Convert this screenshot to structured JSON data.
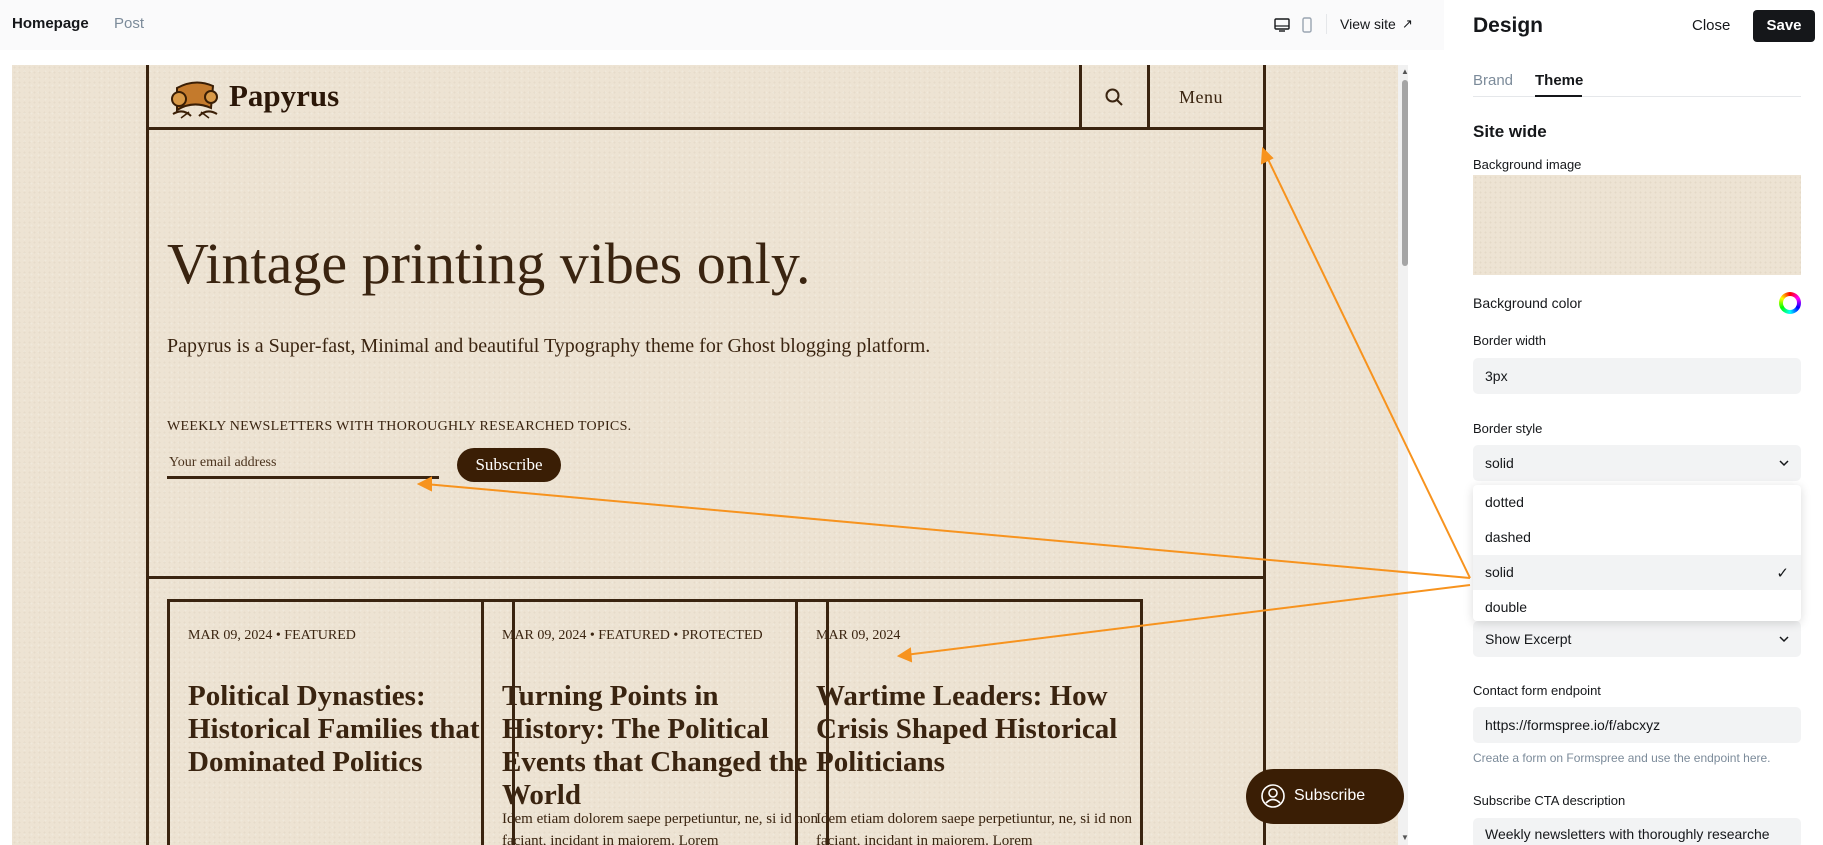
{
  "topbar": {
    "tabs": [
      {
        "label": "Homepage",
        "active": true
      },
      {
        "label": "Post",
        "active": false
      }
    ],
    "view_site": "View site"
  },
  "site": {
    "logo_text": "Papyrus",
    "menu_label": "Menu",
    "hero": {
      "title": "Vintage printing vibes only.",
      "description": "Papyrus is a Super-fast, Minimal and beautiful Typography theme for Ghost blogging platform.",
      "newsletter_text": "WEEKLY NEWSLETTERS WITH THOROUGHLY RESEARCHED TOPICS.",
      "email_placeholder": "Your email address",
      "subscribe_label": "Subscribe"
    },
    "cards": [
      {
        "meta": "MAR 09, 2024 • FEATURED",
        "title": "Political Dynasties: Historical Families that Dominated Politics",
        "excerpt": ""
      },
      {
        "meta": "MAR 09, 2024 • FEATURED • PROTECTED",
        "title": "Turning Points in History: The Political Events that Changed the World",
        "excerpt": "Idem etiam dolorem saepe perpetiuntur, ne, si id non faciant, incidant in majorem. Lorem"
      },
      {
        "meta": "MAR 09, 2024",
        "title": "Wartime Leaders: How Crisis Shaped Historical Politicians",
        "excerpt": "Idem etiam dolorem saepe perpetiuntur, ne, si id non faciant, incidant in majorem. Lorem"
      }
    ],
    "floating_subscribe": "Subscribe"
  },
  "panel": {
    "title": "Design",
    "close_label": "Close",
    "save_label": "Save",
    "tabs": [
      {
        "label": "Brand",
        "active": false
      },
      {
        "label": "Theme",
        "active": true
      }
    ],
    "section_title": "Site wide",
    "background_image_label": "Background image",
    "background_color_label": "Background color",
    "border_width_label": "Border width",
    "border_width_value": "3px",
    "border_style_label": "Border style",
    "border_style_value": "solid",
    "border_style_options": [
      {
        "label": "dotted",
        "selected": false
      },
      {
        "label": "dashed",
        "selected": false
      },
      {
        "label": "solid",
        "selected": true
      },
      {
        "label": "double",
        "selected": false
      }
    ],
    "excerpt_value": "Show Excerpt",
    "contact_label": "Contact form endpoint",
    "contact_value": "https://formspree.io/f/abcxyz",
    "contact_hint": "Create a form on Formspree and use the endpoint here.",
    "cta_label": "Subscribe CTA description",
    "cta_value": "Weekly newsletters with thoroughly researche"
  },
  "colors": {
    "paper": "#ede3d3",
    "ink": "#3a2410",
    "button_dark": "#3a1e05",
    "annotation_arrow": "#f7931e",
    "save_button": "#15171a"
  },
  "icons": [
    "desktop-icon",
    "mobile-icon",
    "external-link-icon",
    "search-icon",
    "chevron-down-icon",
    "check-icon",
    "color-wheel-icon",
    "member-icon",
    "logo-scroll-icon"
  ]
}
